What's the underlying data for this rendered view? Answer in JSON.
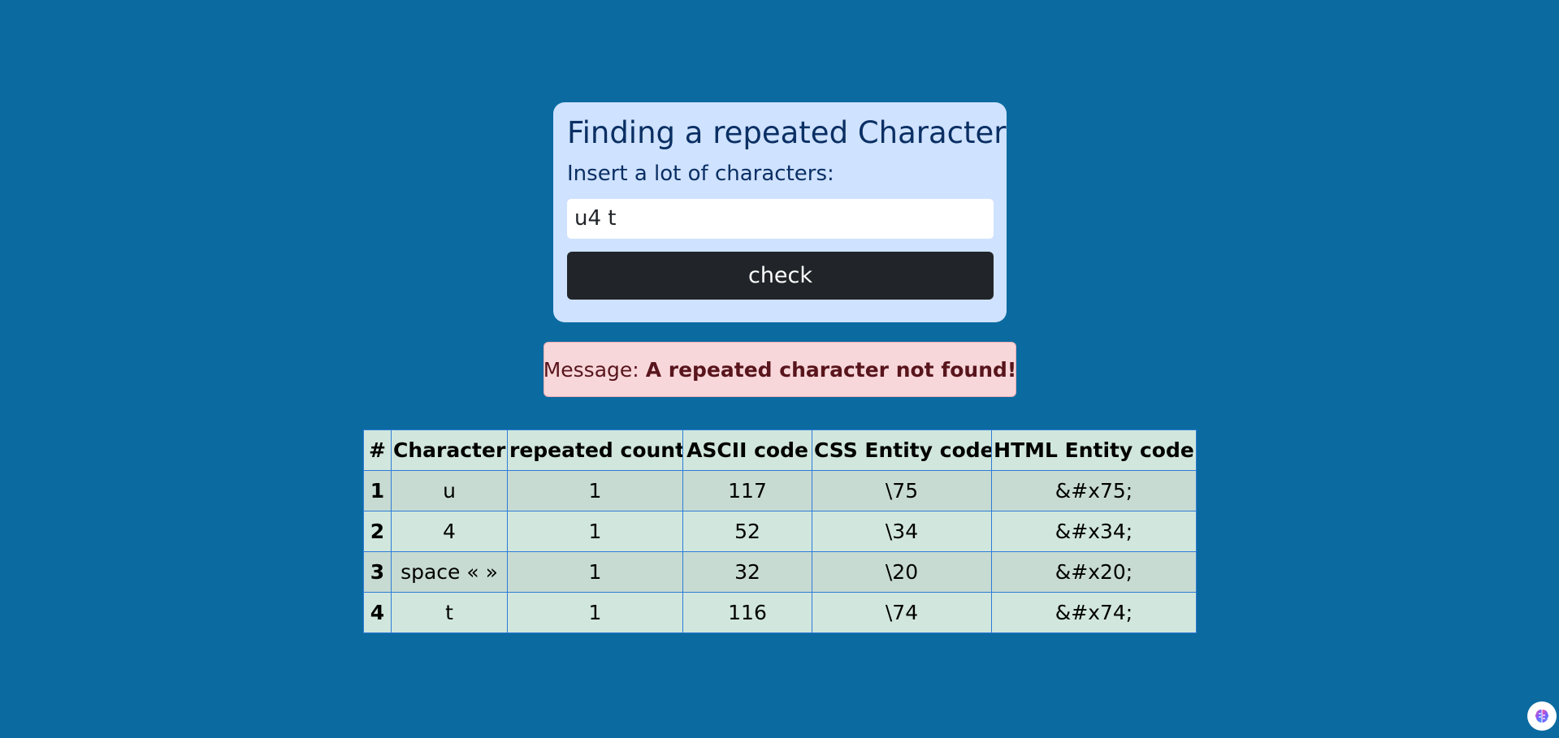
{
  "card": {
    "title": "Finding a repeated Character",
    "label": "Insert a lot of characters:",
    "input_value": "u4 t",
    "check_label": "check"
  },
  "message": {
    "prefix": "Message:",
    "text": "A repeated character not found!"
  },
  "table": {
    "headers": [
      "#",
      "Character",
      "repeated count",
      "ASCII code",
      "CSS Entity code",
      "HTML Entity code"
    ],
    "rows": [
      [
        "1",
        "u",
        "1",
        "117",
        "\\75",
        "&#x75;"
      ],
      [
        "2",
        "4",
        "1",
        "52",
        "\\34",
        "&#x34;"
      ],
      [
        "3",
        "space « »",
        "1",
        "32",
        "\\20",
        "&#x20;"
      ],
      [
        "4",
        "t",
        "1",
        "116",
        "\\74",
        "&#x74;"
      ]
    ]
  },
  "corner_widget": {
    "icon": "brain-icon",
    "colors": [
      "#ff4fa3",
      "#7b5cff",
      "#3da5ff"
    ]
  }
}
